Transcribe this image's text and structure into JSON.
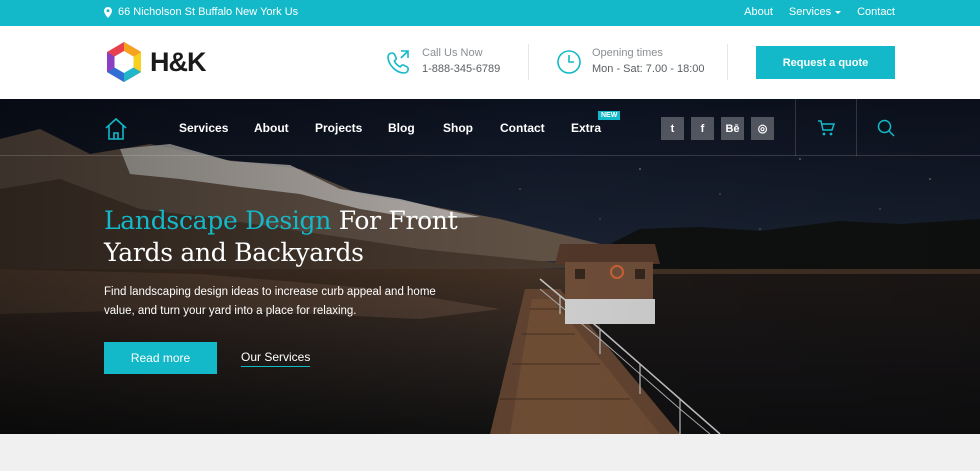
{
  "topbar": {
    "address": "66 Nicholson St Buffalo New York Us",
    "links": [
      "About",
      "Services",
      "Contact"
    ]
  },
  "header": {
    "logo_text": "H&K",
    "call": {
      "label": "Call Us Now",
      "value": "1-888-345-6789",
      "icon": "phone-icon"
    },
    "hours": {
      "label": "Opening times",
      "value": "Mon - Sat: 7.00 - 18:00",
      "icon": "clock-icon"
    },
    "quote_button": "Request a quote"
  },
  "nav": {
    "items": [
      "Services",
      "About",
      "Projects",
      "Blog",
      "Shop",
      "Contact",
      "Extra"
    ],
    "badge": "NEW",
    "social": [
      "twitter-icon",
      "facebook-icon",
      "behance-icon",
      "dribbble-icon"
    ],
    "social_glyphs": [
      "t",
      "f",
      "Bē",
      "◎"
    ]
  },
  "hero": {
    "title_accent": "Landscape Design",
    "title_rest": " For Front Yards and Backyards",
    "description": "Find landscaping design ideas to increase curb appeal and home value, and turn your yard into a place for relaxing.",
    "primary_button": "Read more",
    "secondary_link": "Our Services"
  },
  "colors": {
    "accent": "#13b9c8"
  }
}
